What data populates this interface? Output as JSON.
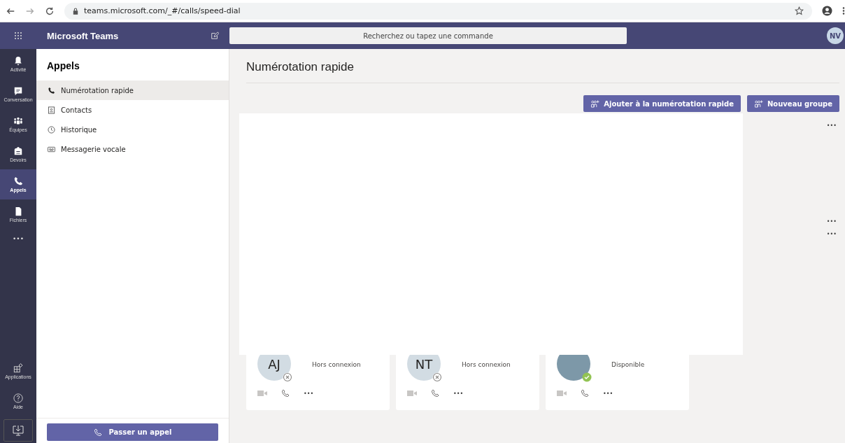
{
  "browser": {
    "url": "teams.microsoft.com/_#/calls/speed-dial"
  },
  "header": {
    "app_name": "Microsoft Teams",
    "search": {
      "placeholder": "Recherchez ou tapez une commande"
    },
    "avatar": "NV"
  },
  "rail": {
    "items": [
      {
        "label": "Activité",
        "selected": false
      },
      {
        "label": "Conversation",
        "selected": false
      },
      {
        "label": "Équipes",
        "selected": false
      },
      {
        "label": "Devoirs",
        "selected": false
      },
      {
        "label": "Appels",
        "selected": true
      },
      {
        "label": "Fichiers",
        "selected": false
      }
    ],
    "more": "•••",
    "bottom": [
      {
        "label": "Applications"
      },
      {
        "label": "Aide"
      }
    ]
  },
  "panel": {
    "title": "Appels",
    "items": [
      {
        "label": "Numérotation rapide",
        "selected": true
      },
      {
        "label": "Contacts",
        "selected": false
      },
      {
        "label": "Historique",
        "selected": false
      },
      {
        "label": "Messagerie vocale",
        "selected": false
      }
    ],
    "call_button": "Passer un appel"
  },
  "main": {
    "title": "Numérotation rapide",
    "buttons": [
      "Ajouter à la numérotation rapide",
      "Nouveau groupe"
    ],
    "more_menus": [
      "•••",
      "•••",
      "•••"
    ],
    "cards": [
      {
        "kind": "initials",
        "initials": "AJ",
        "available": false,
        "status": "Hors connexion",
        "more": "•••"
      },
      {
        "kind": "initials",
        "initials": "NT",
        "available": false,
        "status": "Hors connexion",
        "more": "•••"
      },
      {
        "kind": "photo",
        "available": true,
        "status": "Disponible",
        "more": "•••"
      }
    ]
  }
}
